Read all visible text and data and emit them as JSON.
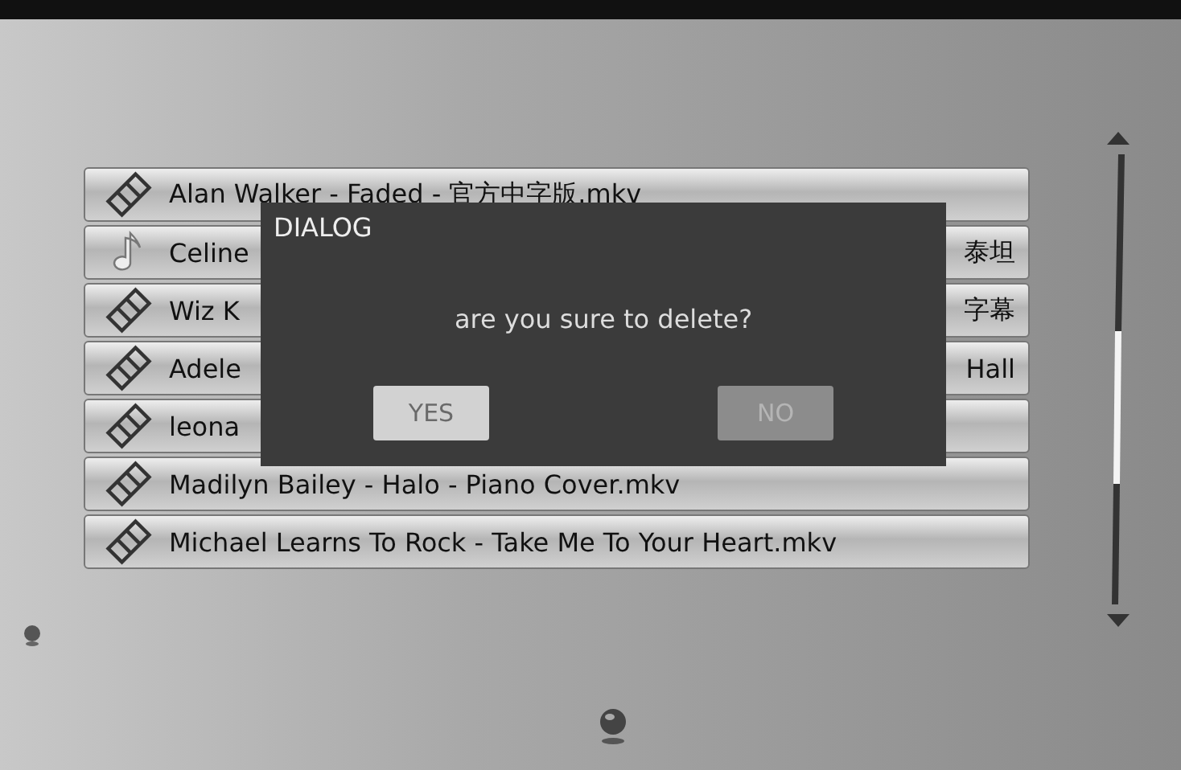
{
  "files": [
    {
      "kind": "video",
      "text": "Alan Walker - Faded - 官方中字版.mkv"
    },
    {
      "kind": "music",
      "text": "Celine",
      "text_right": "泰坦"
    },
    {
      "kind": "video",
      "text": "Wiz K",
      "text_right": "字幕"
    },
    {
      "kind": "video",
      "text": "Adele",
      "text_right": "Hall"
    },
    {
      "kind": "video",
      "text": "leona"
    },
    {
      "kind": "video",
      "text": "Madilyn Bailey - Halo - Piano Cover.mkv"
    },
    {
      "kind": "video",
      "text": "Michael Learns To Rock - Take Me To Your Heart.mkv"
    }
  ],
  "dialog": {
    "title": "DIALOG",
    "message": "are you sure to delete?",
    "buttons": [
      {
        "label": "YES",
        "selected": true
      },
      {
        "label": "NO",
        "selected": false
      }
    ]
  }
}
